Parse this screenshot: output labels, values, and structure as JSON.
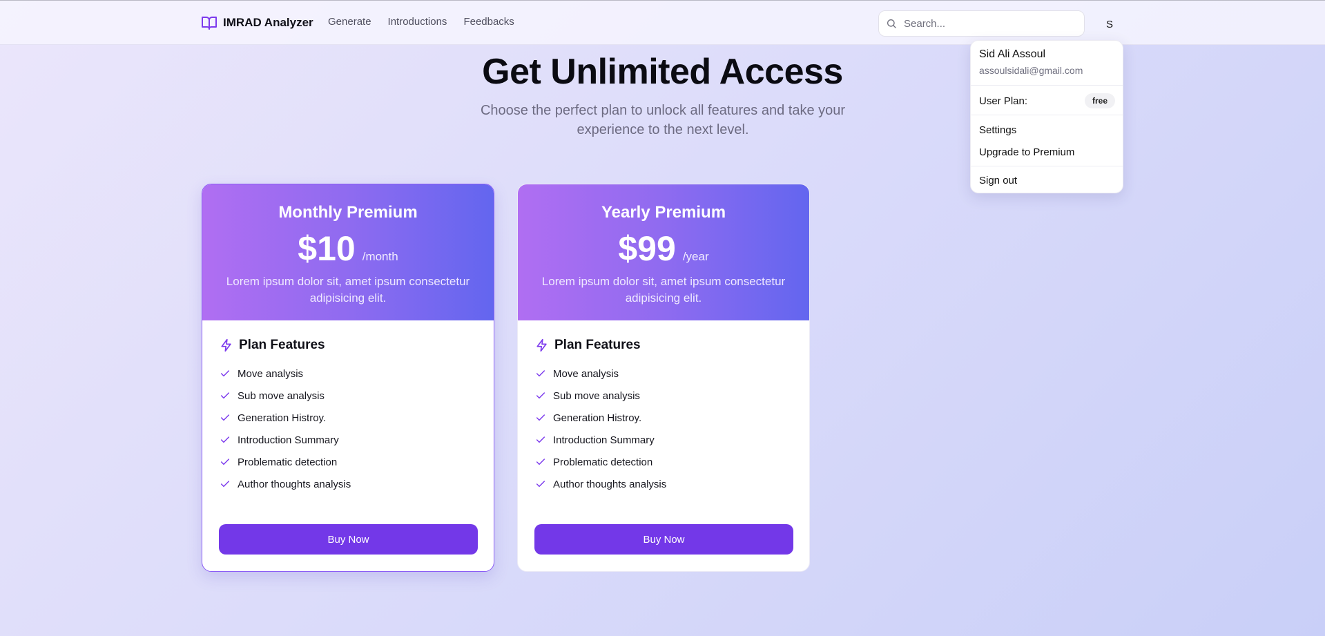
{
  "header": {
    "brand": "IMRAD Analyzer",
    "nav": [
      "Generate",
      "Introductions",
      "Feedbacks"
    ],
    "search_placeholder": "Search...",
    "avatar_initial": "S"
  },
  "hero": {
    "title": "Get Unlimited Access",
    "subtitle": "Choose the perfect plan to unlock all features and take your experience to the next level."
  },
  "plans": [
    {
      "title": "Monthly Premium",
      "price": "$10",
      "period": "/month",
      "description": "Lorem ipsum dolor sit, amet ipsum consectetur adipisicing elit.",
      "features_title": "Plan Features",
      "features": [
        "Move analysis",
        "Sub move analysis",
        "Generation Histroy.",
        "Introduction Summary",
        "Problematic detection",
        "Author thoughts analysis"
      ],
      "button": "Buy Now"
    },
    {
      "title": "Yearly Premium",
      "price": "$99",
      "period": "/year",
      "description": "Lorem ipsum dolor sit, amet ipsum consectetur adipisicing elit.",
      "features_title": "Plan Features",
      "features": [
        "Move analysis",
        "Sub move analysis",
        "Generation Histroy.",
        "Introduction Summary",
        "Problematic detection",
        "Author thoughts analysis"
      ],
      "button": "Buy Now"
    }
  ],
  "user_menu": {
    "name": "Sid Ali Assoul",
    "email": "assoulsidali@gmail.com",
    "plan_label": "User Plan:",
    "plan_value": "free",
    "items": [
      "Settings",
      "Upgrade to Premium"
    ],
    "sign_out": "Sign out"
  },
  "icons": {
    "brand": "book-open-icon",
    "search": "search-icon",
    "features": "lightning-bolt-icon",
    "feature_item": "check-icon"
  },
  "colors": {
    "accent": "#7338e8",
    "card_gradient_start": "#b06ef2",
    "card_gradient_end": "#6366ef"
  }
}
